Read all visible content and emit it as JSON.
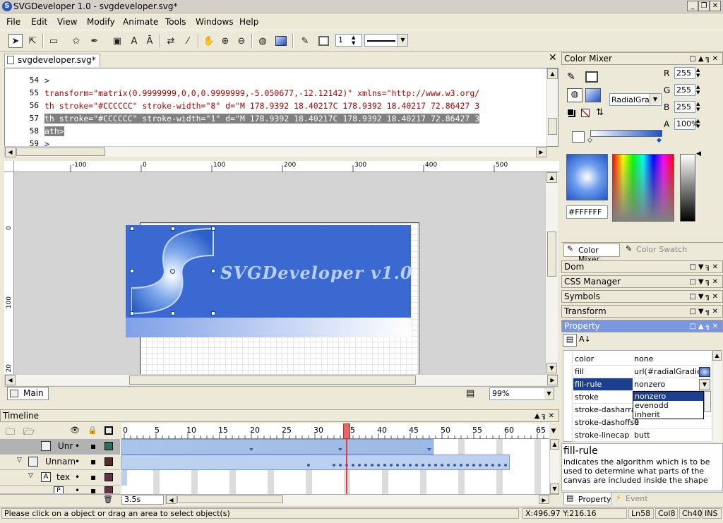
{
  "window": {
    "title": "SVGDeveloper 1.0 - svgdeveloper.svg*",
    "controls": [
      "_",
      "❐",
      "✕"
    ]
  },
  "menu": [
    "File",
    "Edit",
    "View",
    "Modify",
    "Animate",
    "Tools",
    "Windows",
    "Help"
  ],
  "toolbar": {
    "stroke_width": "1"
  },
  "document": {
    "tab_label": "svgdeveloper.svg*",
    "close": "✕"
  },
  "code": {
    "lines": [
      {
        "num": "54",
        "text": ">"
      },
      {
        "num": "55",
        "text": "transform=\"matrix(0.9999999,0,0,0.9999999,-5.050677,-12.12142)\" xmlns=\"http://www.w3.org/"
      },
      {
        "num": "56",
        "text": "th stroke=\"#CCCCCC\" stroke-width=\"8\" d=\"M 178.9392 18.40217C 178.9392 18.40217 72.86427 3"
      },
      {
        "num": "57",
        "text": "th stroke=\"#CCCCCC\" stroke-width=\"1\" d=\"M 178.9392 18.40217C 178.9392 18.40217 72.86427 3"
      },
      {
        "num": "58",
        "text": "ath>"
      },
      {
        "num": "59",
        "text": ">"
      }
    ]
  },
  "ruler": {
    "h_labels": [
      "-100",
      "0",
      "100",
      "200",
      "300",
      "400",
      "500"
    ],
    "v_labels": [
      "0",
      "100",
      "20"
    ]
  },
  "canvas": {
    "logo_text": "SVGDeveloper v1.0"
  },
  "pagebar": {
    "tab_label": "Main",
    "zoom": "99%"
  },
  "color_mixer": {
    "title": "Color Mixer",
    "r_label": "R",
    "r_value": "255",
    "g_label": "G",
    "g_value": "255",
    "b_label": "B",
    "b_value": "255",
    "a_label": "A",
    "a_value": "100%",
    "fill_type": "RadialGrac",
    "hex": "#FFFFFF",
    "tab_mixer": "Color Mixer",
    "tab_swatch": "Color Swatch"
  },
  "panels": [
    "Dom",
    "CSS Manager",
    "Symbols",
    "Transform",
    "Property"
  ],
  "properties": {
    "rows": [
      {
        "key": "color",
        "value": "none"
      },
      {
        "key": "fill",
        "value": "url(#radialGradient"
      },
      {
        "key": "fill-rule",
        "value": "nonzero"
      },
      {
        "key": "stroke",
        "value": ""
      },
      {
        "key": "stroke-dasharray",
        "value": ""
      },
      {
        "key": "stroke-dashoffse",
        "value": "0"
      },
      {
        "key": "stroke-linecap",
        "value": "butt"
      }
    ],
    "dropdown_options": [
      "nonzero",
      "evenodd",
      "inherit"
    ],
    "help_title": "fill-rule",
    "help_text": "indicates the algorithm which is to be used to determine what parts of the canvas are included inside the shape",
    "tab_property": "Property",
    "tab_event": "Event"
  },
  "timeline": {
    "title": "Timeline",
    "frame_numbers": [
      "0",
      "5",
      "10",
      "15",
      "20",
      "25",
      "30",
      "35",
      "40",
      "45",
      "50",
      "55",
      "60",
      "65"
    ],
    "current_frame": "35",
    "layers": [
      "Unr",
      "Unnam",
      "tex",
      ""
    ],
    "time": "3.5s"
  },
  "status": {
    "message": "Please click on a object or drag an area to select object(s)",
    "coords": "X:496.97 Y:216.16",
    "line": "Ln58",
    "col": "Col8",
    "ch": "Ch40",
    "mode": "INS"
  }
}
